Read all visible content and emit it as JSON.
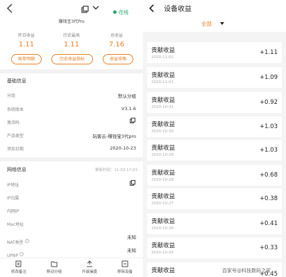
{
  "left": {
    "device_name": "赚钱宝3代Pro",
    "status": "在线",
    "stats": [
      {
        "label": "昨日收益",
        "value": "1.11"
      },
      {
        "label": "历史最高",
        "value": "1.11"
      },
      {
        "label": "总收益",
        "value": "7.16"
      }
    ],
    "buttons": [
      "账单明细",
      "历史收益指标",
      "收益攻略"
    ],
    "basic": {
      "title": "基础信息",
      "rows": [
        {
          "label": "分组",
          "value": "默认分组"
        },
        {
          "label": "系统版本",
          "value": "V3.1.6"
        },
        {
          "label": "激活码",
          "value": ""
        },
        {
          "label": "产品类型",
          "value": "玩客云-赚钱宝3代pro"
        },
        {
          "label": "添加日期",
          "value": "2020-10-23"
        }
      ]
    },
    "network": {
      "title": "网络信息",
      "update_time": "更新时间：11-03 17:03",
      "rows": [
        {
          "label": "IP地址",
          "value": ""
        },
        {
          "label": "IP归属",
          "value": ""
        },
        {
          "label": "内网IP",
          "value": ""
        },
        {
          "label": "Mac地址",
          "value": ""
        },
        {
          "label": "NAT类型",
          "value": "未知"
        },
        {
          "label": "UPNP",
          "value": "未知"
        }
      ]
    },
    "bottom_nav": [
      "修改备注",
      "移动分组",
      "升级操盘",
      "移除设备"
    ]
  },
  "right": {
    "title": "设备收益",
    "filter": "全部",
    "items": [
      {
        "title": "贡献收益",
        "date": "2020-11-02",
        "value": "+1.11"
      },
      {
        "title": "贡献收益",
        "date": "2020-11-01",
        "value": "+1.09"
      },
      {
        "title": "贡献收益",
        "date": "2020-10-31",
        "value": "+0.92"
      },
      {
        "title": "贡献收益",
        "date": "2020-10-30",
        "value": "+1.03"
      },
      {
        "title": "贡献收益",
        "date": "2020-10-29",
        "value": "+1.03"
      },
      {
        "title": "贡献收益",
        "date": "2020-10-28",
        "value": "+0.68"
      },
      {
        "title": "贡献收益",
        "date": "2020-10-27",
        "value": "+0.38"
      },
      {
        "title": "贡献收益",
        "date": "2020-10-26",
        "value": "+0.41"
      },
      {
        "title": "贡献收益",
        "date": "2020-10-25",
        "value": "+0.33"
      },
      {
        "title": "贡献收益",
        "date": "",
        "value": "+0.45"
      }
    ]
  },
  "watermark": "百家号@科技数码之家",
  "colors": {
    "accent": "#e87e22",
    "online": "#1aa86b",
    "background": "#f4f4f4"
  }
}
